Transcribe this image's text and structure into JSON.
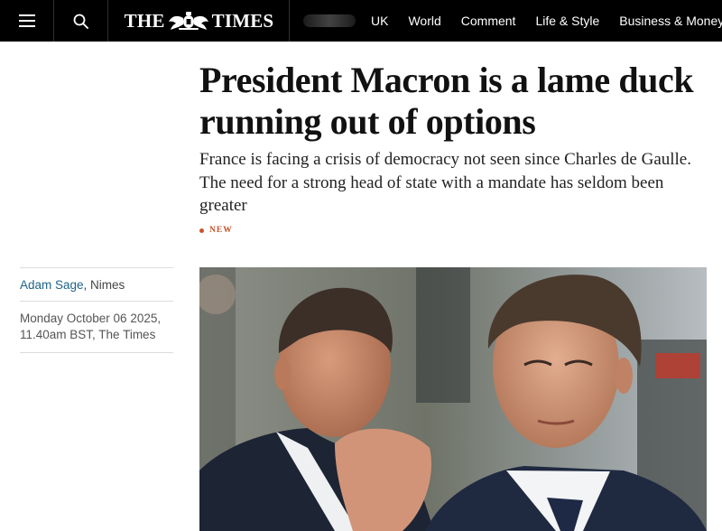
{
  "nav": {
    "masthead_left": "THE",
    "masthead_right": "TIMES",
    "links": [
      "UK",
      "World",
      "Comment",
      "Life & Style",
      "Business & Money"
    ]
  },
  "article": {
    "headline": "President Macron is a lame duck running out of options",
    "standfirst": "France is facing a crisis of democracy not seen since Charles de Gaulle. The need for a strong head of state with a mandate has seldom been greater",
    "tag": "NEW"
  },
  "byline": {
    "author": "Adam Sage",
    "location": ", Nimes",
    "date": "Monday October 06 2025,",
    "time_source": "11.40am BST, The Times"
  },
  "icons": {
    "menu": "hamburger-menu-icon",
    "search": "search-icon",
    "crest": "royal-crest-icon"
  },
  "colors": {
    "topbar": "#000000",
    "author_link": "#1e6489",
    "new_tag": "#c8532a"
  }
}
